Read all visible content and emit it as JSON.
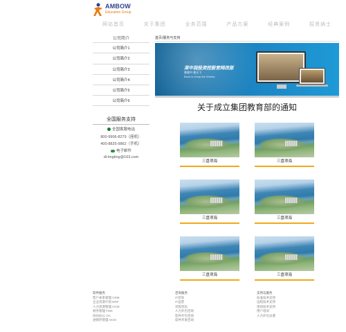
{
  "brand": {
    "name": "AMBOW",
    "tagline": "Education Group",
    "mark_color": "#e87b12"
  },
  "nav": [
    "网站首页",
    "关于集团",
    "业务范围",
    "产品方案",
    "经典案例",
    "招贤纳士"
  ],
  "sidebar": {
    "title": "公司简介",
    "items": [
      "公司简介1",
      "公司简介2",
      "公司简介3",
      "公司简介4",
      "公司简介5",
      "公司简介6"
    ]
  },
  "service": {
    "title": "全国服务支持",
    "hotline_label": "全国客服电话",
    "phone1": "800-9906-8279（座机）",
    "phone2": "400-8825-9862（手机）",
    "email_label": "电子邮件",
    "email": "dl-tingting@163.com"
  },
  "breadcrumb": "首页/服务与支持",
  "banner": {
    "title": "深中润投资控股官网改版",
    "sub": "鼎鼎中·鼎天下",
    "sub2": "Burst to Keep the Worlds"
  },
  "headline": "关于成立集团教育部的通知",
  "cards": [
    "三盘项海",
    "三盘项海",
    "三盘项海",
    "三盘项海",
    "三盘项海",
    "三盘项海"
  ],
  "footer": [
    {
      "title": "软件服务",
      "items": [
        "客户关系管理 CRM",
        "企业资源计划 ERP",
        "人力资源管理 HCM",
        "财务管理 FMS",
        "协同办公 OA",
        "进销存管理 SCM"
      ]
    },
    {
      "title": "咨询服务",
      "items": [
        "IT咨询",
        "IT运营",
        "流程优化",
        "人力外包咨询",
        "软件外包咨询",
        "软件开发咨询"
      ]
    },
    {
      "title": "支持与服务",
      "items": [
        "标准技术支持",
        "远程技术支持",
        "现场技术支持",
        "用户培训",
        "人力外包派遣"
      ]
    }
  ]
}
